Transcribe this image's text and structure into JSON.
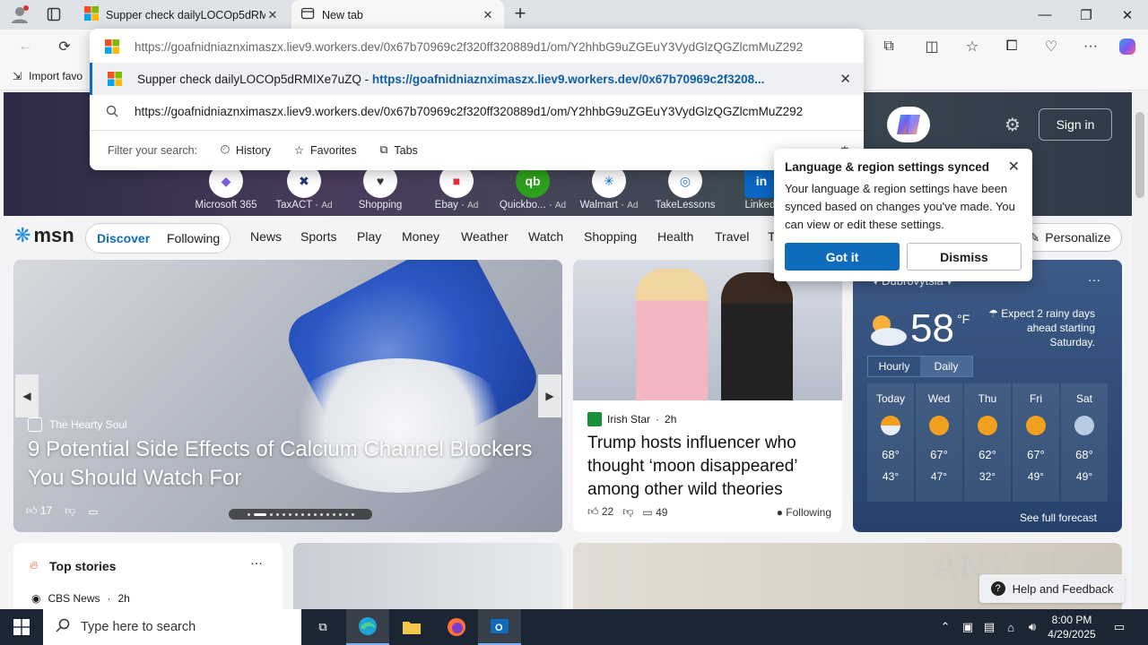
{
  "browser": {
    "tabs": [
      {
        "title": "Supper check dailyLOCOp5dRMI",
        "active": false
      },
      {
        "title": "New tab",
        "active": true
      }
    ],
    "bookmarks_bar": {
      "import_label": "Import favo"
    }
  },
  "omnibox": {
    "input_url_dim": "https://goafnidniaznximaszx.liev9.workers.dev",
    "input_url_rest": "/0x67b70969c2f320ff320889d1/om/Y2hhbG9uZGEuY3VydGlzQGZlcmMuZ292",
    "suggestion": {
      "title": "Supper check dailyLOCOp5dRMIXe7uZQ",
      "separator": "-",
      "url": "https://goafnidniaznximaszx.liev9.workers.dev/0x67b70969c2f3208..."
    },
    "search_row": "https://goafnidniaznximaszx.liev9.workers.dev/0x67b70969c2f320ff320889d1/om/Y2hhbG9uZGEuY3VydGlzQGZlcmMuZ292",
    "filter_label": "Filter your search:",
    "filters": [
      "History",
      "Favorites",
      "Tabs"
    ]
  },
  "hero": {
    "sign_in": "Sign in",
    "tiles": [
      {
        "name": "Microsoft 365",
        "ad": ""
      },
      {
        "name": "TaxACT",
        "ad": "Ad"
      },
      {
        "name": "Shopping",
        "ad": ""
      },
      {
        "name": "Ebay",
        "ad": "Ad"
      },
      {
        "name": "Quickbo...",
        "ad": "Ad"
      },
      {
        "name": "Walmart",
        "ad": "Ad"
      },
      {
        "name": "TakeLessons",
        "ad": ""
      },
      {
        "name": "LinkedI",
        "ad": ""
      }
    ]
  },
  "msn": {
    "logo": "msn",
    "toggle": [
      "Discover",
      "Following"
    ],
    "nav": [
      "News",
      "Sports",
      "Play",
      "Money",
      "Weather",
      "Watch",
      "Shopping",
      "Health",
      "Travel",
      "T"
    ],
    "personalize": "Personalize"
  },
  "popover": {
    "title": "Language & region settings synced",
    "title_visible": "region settings synced",
    "body": "Your language & region settings have been synced based on changes you've made. You can view or edit these settings.",
    "primary": "Got it",
    "secondary": "Dismiss"
  },
  "big_card": {
    "source": "The Hearty Soul",
    "title": "9 Potential Side Effects of Calcium Channel Blockers You Should Watch For",
    "likes": "17"
  },
  "news_card": {
    "source": "Irish Star",
    "age": "2h",
    "title": "Trump hosts influencer who thought ‘moon disappeared’ among other wild theories",
    "likes": "22",
    "comments": "49",
    "following": "Following"
  },
  "weather": {
    "location": "Dubrovytsia",
    "temp": "58",
    "unit": "°F",
    "note": "Expect 2 rainy days ahead starting Saturday.",
    "tabs": [
      "Hourly",
      "Daily"
    ],
    "days": [
      {
        "day": "Today",
        "hi": "68°",
        "lo": "43°",
        "icon": "partly-cloudy-icon"
      },
      {
        "day": "Wed",
        "hi": "67°",
        "lo": "47°",
        "icon": "sun-cloud-icon"
      },
      {
        "day": "Thu",
        "hi": "62°",
        "lo": "32°",
        "icon": "sun-cloud-icon"
      },
      {
        "day": "Fri",
        "hi": "67°",
        "lo": "49°",
        "icon": "sun-icon"
      },
      {
        "day": "Sat",
        "hi": "68°",
        "lo": "49°",
        "icon": "rain-icon"
      }
    ],
    "see_full": "See full forecast"
  },
  "top_stories": {
    "title": "Top stories",
    "source": "CBS News",
    "age": "2h"
  },
  "help": "Help and Feedback",
  "watermark": "ANY RUN",
  "taskbar": {
    "search_placeholder": "Type here to search",
    "time": "8:00 PM",
    "date": "4/29/2025"
  },
  "colors": {
    "accent": "#0f6cbd",
    "taskbar": "#1c2532",
    "weather_bg": "#2f4c78"
  }
}
